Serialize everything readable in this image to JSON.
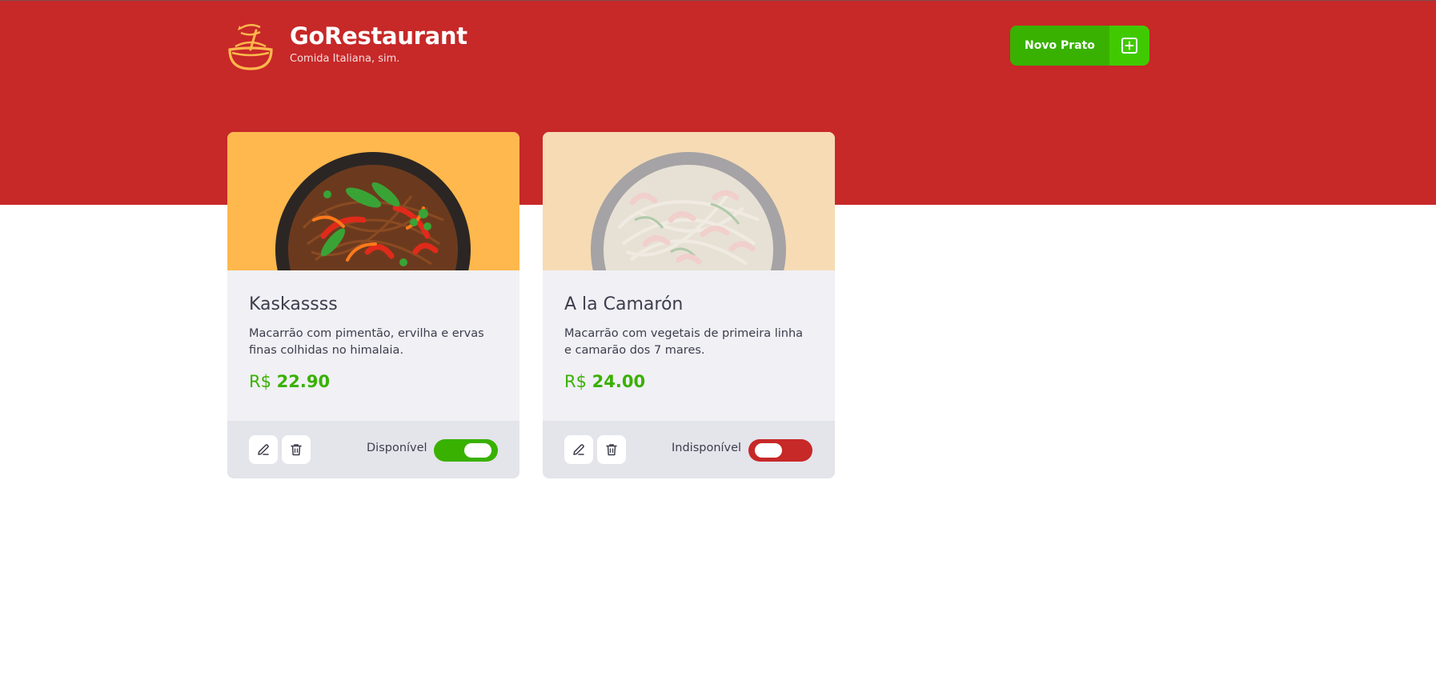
{
  "header": {
    "title": "GoRestaurant",
    "subtitle": "Comida Italiana, sim.",
    "logo_icon": "bowl-icon",
    "new_button_label": "Novo Prato",
    "new_button_icon": "plus-square-icon"
  },
  "colors": {
    "header_bg": "#c72828",
    "accent_green": "#39b100",
    "accent_red": "#c72828",
    "card_bg": "#f0f0f5",
    "card_footer_bg": "#e4e4eb",
    "image_bg_available": "#ffb84d",
    "image_bg_unavailable": "#f4e1c4"
  },
  "foods": [
    {
      "name": "Kaskassss",
      "description": "Macarrão com pimentão, ervilha e ervas finas colhidas no himalaia.",
      "currency": "R$",
      "price": "22.90",
      "status_label": "Disponível",
      "available": true
    },
    {
      "name": "A la Camarón",
      "description": "Macarrão com vegetais de primeira linha e camarão dos 7 mares.",
      "currency": "R$",
      "price": "24.00",
      "status_label": "Indisponível",
      "available": false
    }
  ]
}
